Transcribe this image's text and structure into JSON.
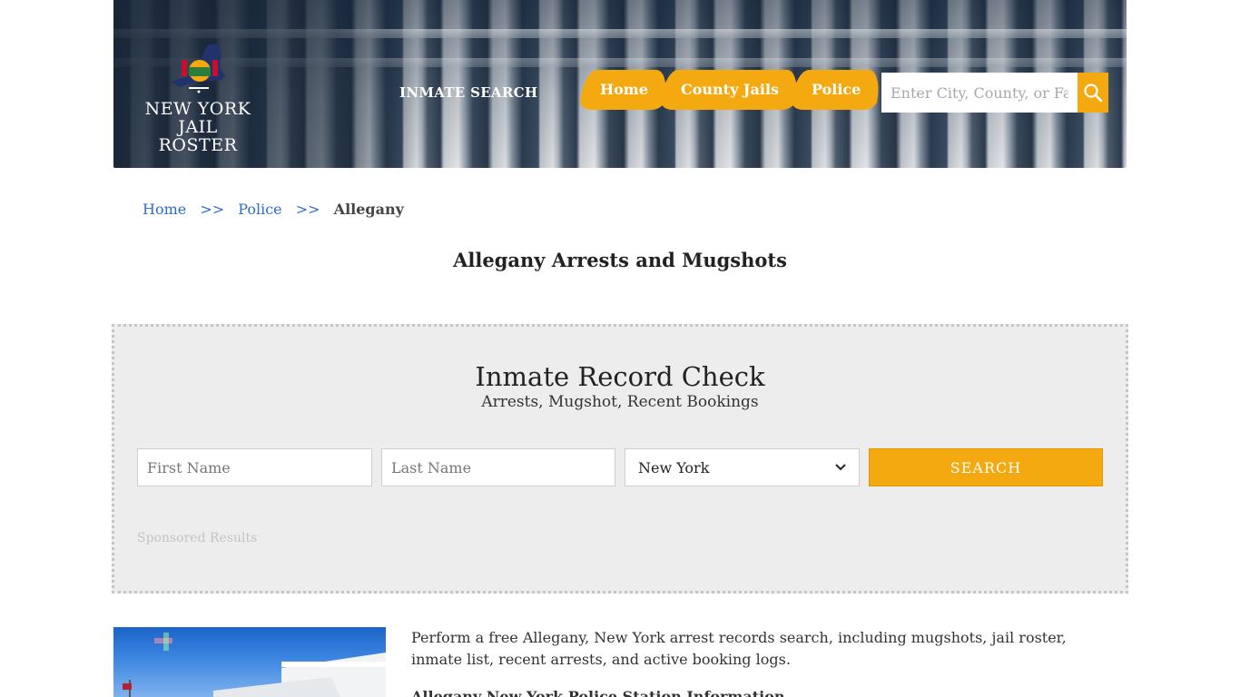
{
  "header": {
    "logo": {
      "line1": "NEW YORK",
      "line2": "JAIL ROSTER"
    },
    "inmate_search_label": "INMATE SEARCH",
    "nav": [
      {
        "label": "Home"
      },
      {
        "label": "County Jails"
      },
      {
        "label": "Police"
      }
    ],
    "search": {
      "placeholder": "Enter City, County, or Facility"
    }
  },
  "breadcrumb": {
    "items": [
      "Home",
      "Police"
    ],
    "separator": ">>",
    "current": "Allegany"
  },
  "page_title": "Allegany Arrests and Mugshots",
  "record_check": {
    "title": "Inmate Record Check",
    "subtitle": "Arrests, Mugshot, Recent Bookings",
    "first_name_placeholder": "First Name",
    "last_name_placeholder": "Last Name",
    "state_selected": "New York",
    "search_label": "SEARCH",
    "sponsored_label": "Sponsored Results"
  },
  "content": {
    "intro": "Perform a free Allegany, New York arrest records search, including mugshots, jail roster, inmate list, recent arrests, and active booking logs.",
    "info_heading": "Allegany New York Police Station Information"
  },
  "colors": {
    "accent": "#f4a910",
    "link": "#2f6dc9",
    "panel_bg": "#ededed"
  }
}
